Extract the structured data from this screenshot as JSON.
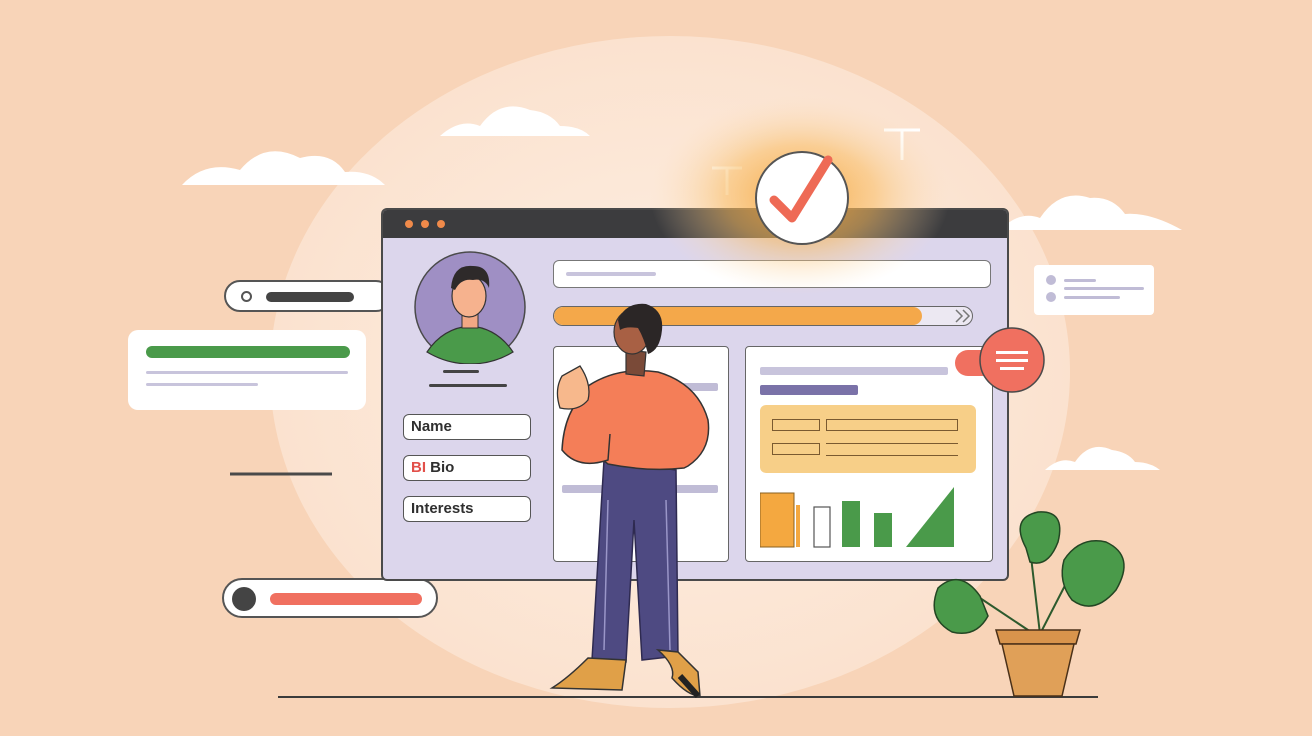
{
  "profile_form": {
    "fields": [
      {
        "label": "Name"
      },
      {
        "bio_prefix": "BI",
        "label": "Bio"
      },
      {
        "label": "Interests"
      }
    ]
  },
  "colors": {
    "background": "#f8d4b8",
    "window_bg": "#dcd6ec",
    "accent_orange": "#f4a84a",
    "accent_green": "#4a9a4a",
    "accent_red": "#f07060",
    "check_red": "#ee6a55"
  },
  "icons": [
    "check-icon",
    "menu-icon",
    "avatar-illustration",
    "plant-illustration"
  ],
  "progress": {
    "fill_fraction": 0.88
  }
}
